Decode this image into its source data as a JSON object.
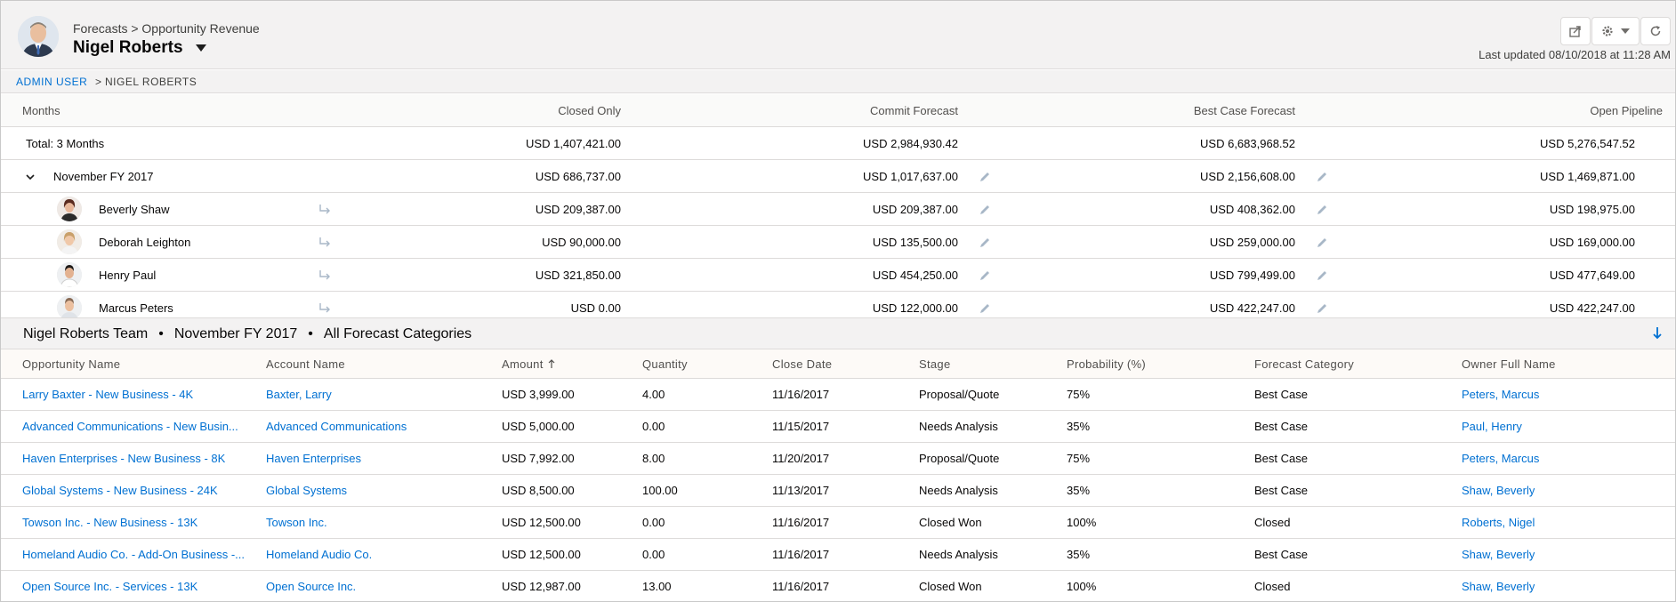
{
  "header": {
    "breadcrumb": "Forecasts > Opportunity Revenue",
    "owner_name": "Nigel Roberts",
    "last_updated": "Last updated 08/10/2018 at 11:28 AM"
  },
  "crumbs": {
    "root": "ADMIN USER",
    "sep": ">",
    "current": "NIGEL ROBERTS"
  },
  "grid": {
    "columns": [
      "Months",
      "Closed Only",
      "Commit Forecast",
      "Best Case Forecast",
      "Open Pipeline"
    ],
    "total": {
      "label": "Total: 3 Months",
      "closed": "USD 1,407,421.00",
      "commit": "USD 2,984,930.42",
      "best": "USD 6,683,968.52",
      "pipeline": "USD 5,276,547.52"
    },
    "period": {
      "label": "November FY 2017",
      "closed": "USD 686,737.00",
      "commit": "USD 1,017,637.00",
      "best": "USD 2,156,608.00",
      "pipeline": "USD 1,469,871.00"
    },
    "people": [
      {
        "name": "Beverly Shaw",
        "closed": "USD 209,387.00",
        "commit": "USD 209,387.00",
        "best": "USD 408,362.00",
        "pipeline": "USD 198,975.00"
      },
      {
        "name": "Deborah Leighton",
        "closed": "USD 90,000.00",
        "commit": "USD 135,500.00",
        "best": "USD 259,000.00",
        "pipeline": "USD 169,000.00"
      },
      {
        "name": "Henry Paul",
        "closed": "USD 321,850.00",
        "commit": "USD 454,250.00",
        "best": "USD 799,499.00",
        "pipeline": "USD 477,649.00"
      },
      {
        "name": "Marcus Peters",
        "closed": "USD 0.00",
        "commit": "USD 122,000.00",
        "best": "USD 422,247.00",
        "pipeline": "USD 422,247.00"
      }
    ]
  },
  "detail": {
    "team": "Nigel Roberts Team",
    "dot": "•",
    "period": "November FY 2017",
    "category": "All Forecast Categories",
    "columns": [
      "Opportunity Name",
      "Account Name",
      "Amount",
      "Quantity",
      "Close Date",
      "Stage",
      "Probability (%)",
      "Forecast Category",
      "Owner Full Name"
    ],
    "rows": [
      [
        "Larry Baxter - New Business - 4K",
        "Baxter, Larry",
        "USD 3,999.00",
        "4.00",
        "11/16/2017",
        "Proposal/Quote",
        "75%",
        "Best Case",
        "Peters, Marcus"
      ],
      [
        "Advanced Communications - New Busin...",
        "Advanced Communications",
        "USD 5,000.00",
        "0.00",
        "11/15/2017",
        "Needs Analysis",
        "35%",
        "Best Case",
        "Paul, Henry"
      ],
      [
        "Haven Enterprises - New Business - 8K",
        "Haven Enterprises",
        "USD 7,992.00",
        "8.00",
        "11/20/2017",
        "Proposal/Quote",
        "75%",
        "Best Case",
        "Peters, Marcus"
      ],
      [
        "Global Systems - New Business - 24K",
        "Global Systems",
        "USD 8,500.00",
        "100.00",
        "11/13/2017",
        "Needs Analysis",
        "35%",
        "Best Case",
        "Shaw, Beverly"
      ],
      [
        "Towson Inc. - New Business - 13K",
        "Towson Inc.",
        "USD 12,500.00",
        "0.00",
        "11/16/2017",
        "Closed Won",
        "100%",
        "Closed",
        "Roberts, Nigel"
      ],
      [
        "Homeland Audio Co. - Add-On Business -...",
        "Homeland Audio Co.",
        "USD 12,500.00",
        "0.00",
        "11/16/2017",
        "Needs Analysis",
        "35%",
        "Best Case",
        "Shaw, Beverly"
      ],
      [
        "Open Source Inc. - Services - 13K",
        "Open Source Inc.",
        "USD 12,987.00",
        "13.00",
        "11/16/2017",
        "Closed Won",
        "100%",
        "Closed",
        "Shaw, Beverly"
      ]
    ]
  },
  "icons": [
    "share-icon",
    "gear-icon",
    "chevron-down-icon",
    "refresh-icon",
    "pencil-icon",
    "reassign-arrow-icon",
    "sort-up-icon",
    "arrow-down-icon"
  ],
  "colors": {
    "link": "#0070d2",
    "header_bg": "#f3f2f2",
    "border": "#dddbda"
  }
}
